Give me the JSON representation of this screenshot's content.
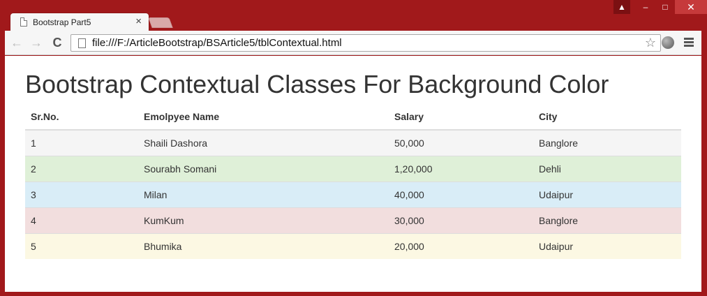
{
  "browser": {
    "tab_title": "Bootstrap Part5",
    "tab_close": "×",
    "url": "file:///F:/ArticleBootstrap/BSArticle5/tblContextual.html",
    "window_controls": {
      "minimize": "–",
      "maximize": "□",
      "close": "✕",
      "user": "▲"
    },
    "icons": {
      "back": "←",
      "forward": "→",
      "reload": "C",
      "star": "☆"
    }
  },
  "page": {
    "title": "Bootstrap Contextual Classes For Background Color",
    "table": {
      "headers": [
        "Sr.No.",
        "Emolpyee Name",
        "Salary",
        "City"
      ],
      "rows": [
        {
          "cells": [
            "1",
            "Shaili Dashora",
            "50,000",
            "Banglore"
          ],
          "context": "active",
          "color": "#f5f5f5"
        },
        {
          "cells": [
            "2",
            "Sourabh Somani",
            "1,20,000",
            "Dehli"
          ],
          "context": "success",
          "color": "#dff0d8"
        },
        {
          "cells": [
            "3",
            "Milan",
            "40,000",
            "Udaipur"
          ],
          "context": "info",
          "color": "#d9edf7"
        },
        {
          "cells": [
            "4",
            "KumKum",
            "30,000",
            "Banglore"
          ],
          "context": "danger",
          "color": "#f2dede"
        },
        {
          "cells": [
            "5",
            "Bhumika",
            "20,000",
            "Udaipur"
          ],
          "context": "warning",
          "color": "#fcf8e3"
        }
      ]
    }
  },
  "colors": {
    "window_frame": "#a1191b",
    "close_button": "#c63a3b"
  }
}
